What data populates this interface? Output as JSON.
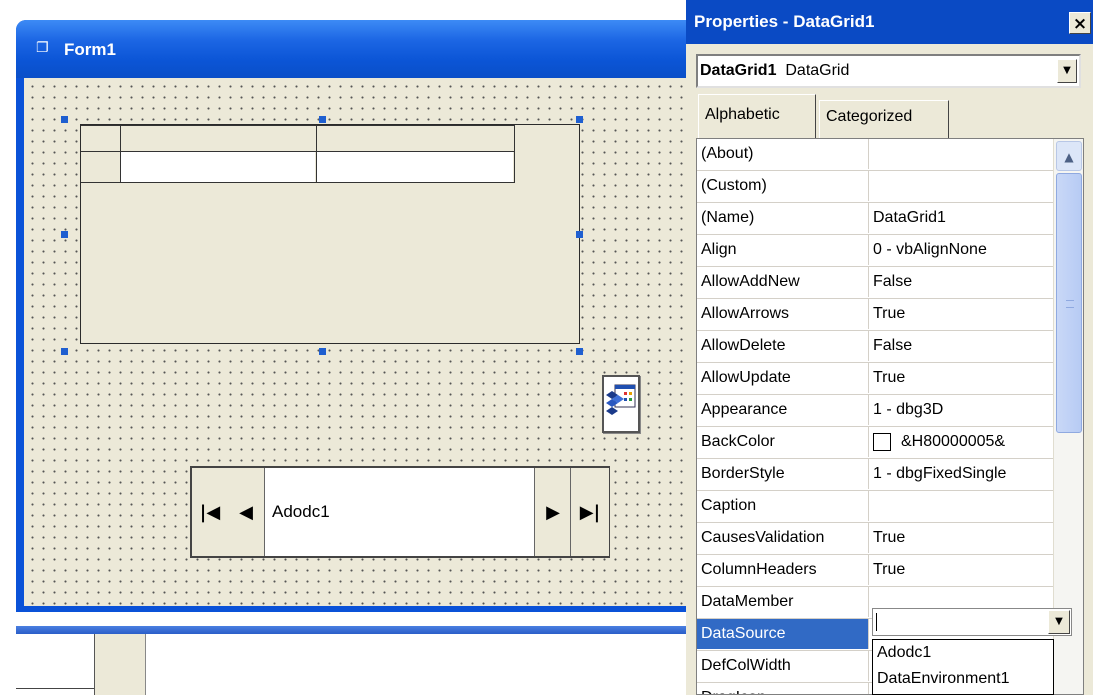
{
  "form": {
    "title": "Form1",
    "icon": "form-icon",
    "ado_control": {
      "caption": "Adodc1",
      "buttons": {
        "first": "first-record-icon",
        "prev": "previous-record-icon",
        "next": "next-record-icon",
        "last": "last-record-icon"
      }
    },
    "data_environment_icon": "data-environment-icon"
  },
  "properties": {
    "title": "Properties - DataGrid1",
    "close_label": "×",
    "object_combo": {
      "name": "DataGrid1",
      "type": "DataGrid"
    },
    "tabs": [
      {
        "label": "Alphabetic",
        "active": true
      },
      {
        "label": "Categorized",
        "active": false
      }
    ],
    "rows": [
      {
        "name": "(About)",
        "value": ""
      },
      {
        "name": "(Custom)",
        "value": ""
      },
      {
        "name": "(Name)",
        "value": "DataGrid1"
      },
      {
        "name": "Align",
        "value": "0 - vbAlignNone"
      },
      {
        "name": "AllowAddNew",
        "value": "False"
      },
      {
        "name": "AllowArrows",
        "value": "True"
      },
      {
        "name": "AllowDelete",
        "value": "False"
      },
      {
        "name": "AllowUpdate",
        "value": "True"
      },
      {
        "name": "Appearance",
        "value": "1 - dbg3D"
      },
      {
        "name": "BackColor",
        "value": "&H80000005&",
        "swatch_color": "#ffffff"
      },
      {
        "name": "BorderStyle",
        "value": "1 - dbgFixedSingle"
      },
      {
        "name": "Caption",
        "value": ""
      },
      {
        "name": "CausesValidation",
        "value": "True"
      },
      {
        "name": "ColumnHeaders",
        "value": "True"
      },
      {
        "name": "DataMember",
        "value": ""
      },
      {
        "name": "DataSource",
        "value": "",
        "selected": true
      },
      {
        "name": "DefColWidth",
        "value": ""
      },
      {
        "name": "DragIcon",
        "value": ""
      }
    ],
    "datasource_dropdown": [
      "Adodc1",
      "DataEnvironment1"
    ],
    "selection_color": "#316ac5"
  },
  "colors": {
    "titlebar": "#0a52d8",
    "form_face": "#ece9d8",
    "selection_handle": "#1f5fd0"
  }
}
